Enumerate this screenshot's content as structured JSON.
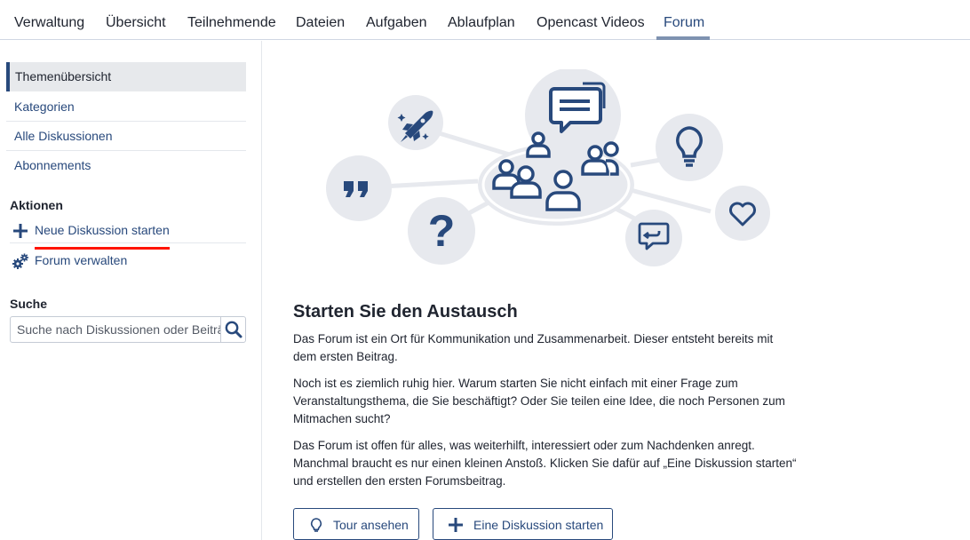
{
  "tabs": [
    {
      "label": "Verwaltung"
    },
    {
      "label": "Übersicht"
    },
    {
      "label": "Teilnehmende"
    },
    {
      "label": "Dateien"
    },
    {
      "label": "Aufgaben"
    },
    {
      "label": "Ablaufplan"
    },
    {
      "label": "Opencast Videos"
    },
    {
      "label": "Forum",
      "active": true
    }
  ],
  "sidebar": {
    "nav": [
      {
        "label": "Themenübersicht",
        "active": true
      },
      {
        "label": "Kategorien"
      },
      {
        "label": "Alle Diskussionen"
      },
      {
        "label": "Abonnements"
      }
    ],
    "actions_heading": "Aktionen",
    "actions": [
      {
        "label": "Neue Diskussion starten",
        "icon": "plus-icon"
      },
      {
        "label": "Forum verwalten",
        "icon": "gears-icon"
      }
    ],
    "search_heading": "Suche",
    "search_placeholder": "Suche nach Diskussionen oder Beiträgen"
  },
  "main": {
    "title": "Starten Sie den Austausch",
    "paragraphs": [
      "Das Forum ist ein Ort für Kommunikation und Zusammenarbeit. Dieser entsteht bereits mit dem ersten Beitrag.",
      "Noch ist es ziemlich ruhig hier. Warum starten Sie nicht einfach mit einer Frage zum Veranstaltungsthema, die Sie beschäftigt? Oder Sie teilen eine Idee, die noch Personen zum Mitmachen sucht?",
      "Das Forum ist offen für alles, was weiterhilft, interessiert oder zum Nachdenken anregt. Manchmal braucht es nur einen kleinen Anstoß. Klicken Sie dafür auf „Eine Diskussion starten“ und erstellen den ersten Forumsbeitrag."
    ],
    "buttons": {
      "tour": "Tour ansehen",
      "start": "Eine Diskussion starten"
    }
  },
  "colors": {
    "brand": "#28497c",
    "text": "#202530",
    "circle": "#e7e9ee",
    "highlight": "#ff1400"
  }
}
